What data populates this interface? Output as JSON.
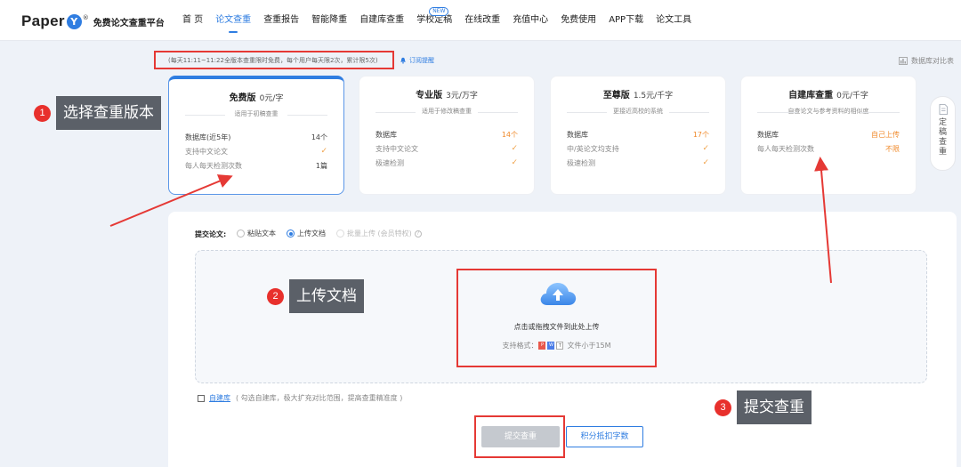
{
  "header": {
    "logo_text": "Paper",
    "logo_badge": "Y",
    "logo_reg": "®",
    "logo_sub": "免费论文查重平台",
    "nav": [
      {
        "label": "首 页",
        "active": false
      },
      {
        "label": "论文查重",
        "active": true
      },
      {
        "label": "查重报告",
        "active": false
      },
      {
        "label": "智能降重",
        "active": false
      },
      {
        "label": "自建库查重",
        "active": false
      },
      {
        "label": "学校定稿",
        "active": false,
        "badge": "NEW"
      },
      {
        "label": "在线改重",
        "active": false
      },
      {
        "label": "充值中心",
        "active": false
      },
      {
        "label": "免费使用",
        "active": false
      },
      {
        "label": "APP下载",
        "active": false
      },
      {
        "label": "论文工具",
        "active": false
      }
    ]
  },
  "notice": {
    "text": "(每天11:11~11:22全版本查重限时免费，每个用户每天限2次，累计限5次)",
    "subscribe": "订阅提醒",
    "compare": "数据库对比表"
  },
  "cards": [
    {
      "title": "免费版",
      "price": "0元/字",
      "subtitle": "适用于初稿查重",
      "selected": true,
      "rows": [
        {
          "k": "数据库(近5年)",
          "v": "14个",
          "k_muted": false,
          "v_style": "normal"
        },
        {
          "k": "支持中文论文",
          "v": "✓",
          "k_muted": true,
          "v_style": "check"
        },
        {
          "k": "每人每天检测次数",
          "v": "1篇",
          "k_muted": true,
          "v_style": "normal"
        }
      ]
    },
    {
      "title": "专业版",
      "price": "3元/万字",
      "subtitle": "适用于修改稿查重",
      "selected": false,
      "rows": [
        {
          "k": "数据库",
          "v": "14个",
          "k_muted": false,
          "v_style": "orange"
        },
        {
          "k": "支持中文论文",
          "v": "✓",
          "k_muted": true,
          "v_style": "check"
        },
        {
          "k": "极速检测",
          "v": "✓",
          "k_muted": true,
          "v_style": "check"
        }
      ]
    },
    {
      "title": "至尊版",
      "price": "1.5元/千字",
      "subtitle": "更接近高校的系统",
      "selected": false,
      "rows": [
        {
          "k": "数据库",
          "v": "17个",
          "k_muted": false,
          "v_style": "orange"
        },
        {
          "k": "中/英论文均支持",
          "v": "✓",
          "k_muted": true,
          "v_style": "check"
        },
        {
          "k": "极速检测",
          "v": "✓",
          "k_muted": true,
          "v_style": "check"
        }
      ]
    },
    {
      "title": "自建库查重",
      "price": "0元/千字",
      "subtitle": "自查论文与参考资料的相似度",
      "selected": false,
      "rows": [
        {
          "k": "数据库",
          "v": "自己上传",
          "k_muted": false,
          "v_style": "orange"
        },
        {
          "k": "每人每天检测次数",
          "v": "不限",
          "k_muted": true,
          "v_style": "orange"
        }
      ]
    }
  ],
  "side_tab": {
    "label": "定稿查重"
  },
  "upload": {
    "submit_label": "提交论文:",
    "options": [
      {
        "label": "粘贴文本",
        "checked": false,
        "disabled": false
      },
      {
        "label": "上传文档",
        "checked": true,
        "disabled": false
      },
      {
        "label": "批量上传 (会员特权)",
        "checked": false,
        "disabled": true
      }
    ],
    "help": "?",
    "drop_text": "点击或拖拽文件到此处上传",
    "formats_prefix": "支持格式：",
    "formats_suffix": "文件小于15M",
    "format_pdf": "P",
    "format_doc": "W",
    "format_txt": "T",
    "self_db_link": "自建库",
    "self_db_hint": "( 勾选自建库，极大扩充对比范围，提高查重精准度 )",
    "submit_button": "提交查重",
    "points_button": "积分抵扣字数"
  },
  "steps": [
    {
      "num": "1",
      "label": "选择查重版本"
    },
    {
      "num": "2",
      "label": "上传文档"
    },
    {
      "num": "3",
      "label": "提交查重"
    }
  ],
  "colors": {
    "accent": "#2f7de1",
    "annotation_red": "#e53935",
    "label_bg": "#5b6068"
  }
}
